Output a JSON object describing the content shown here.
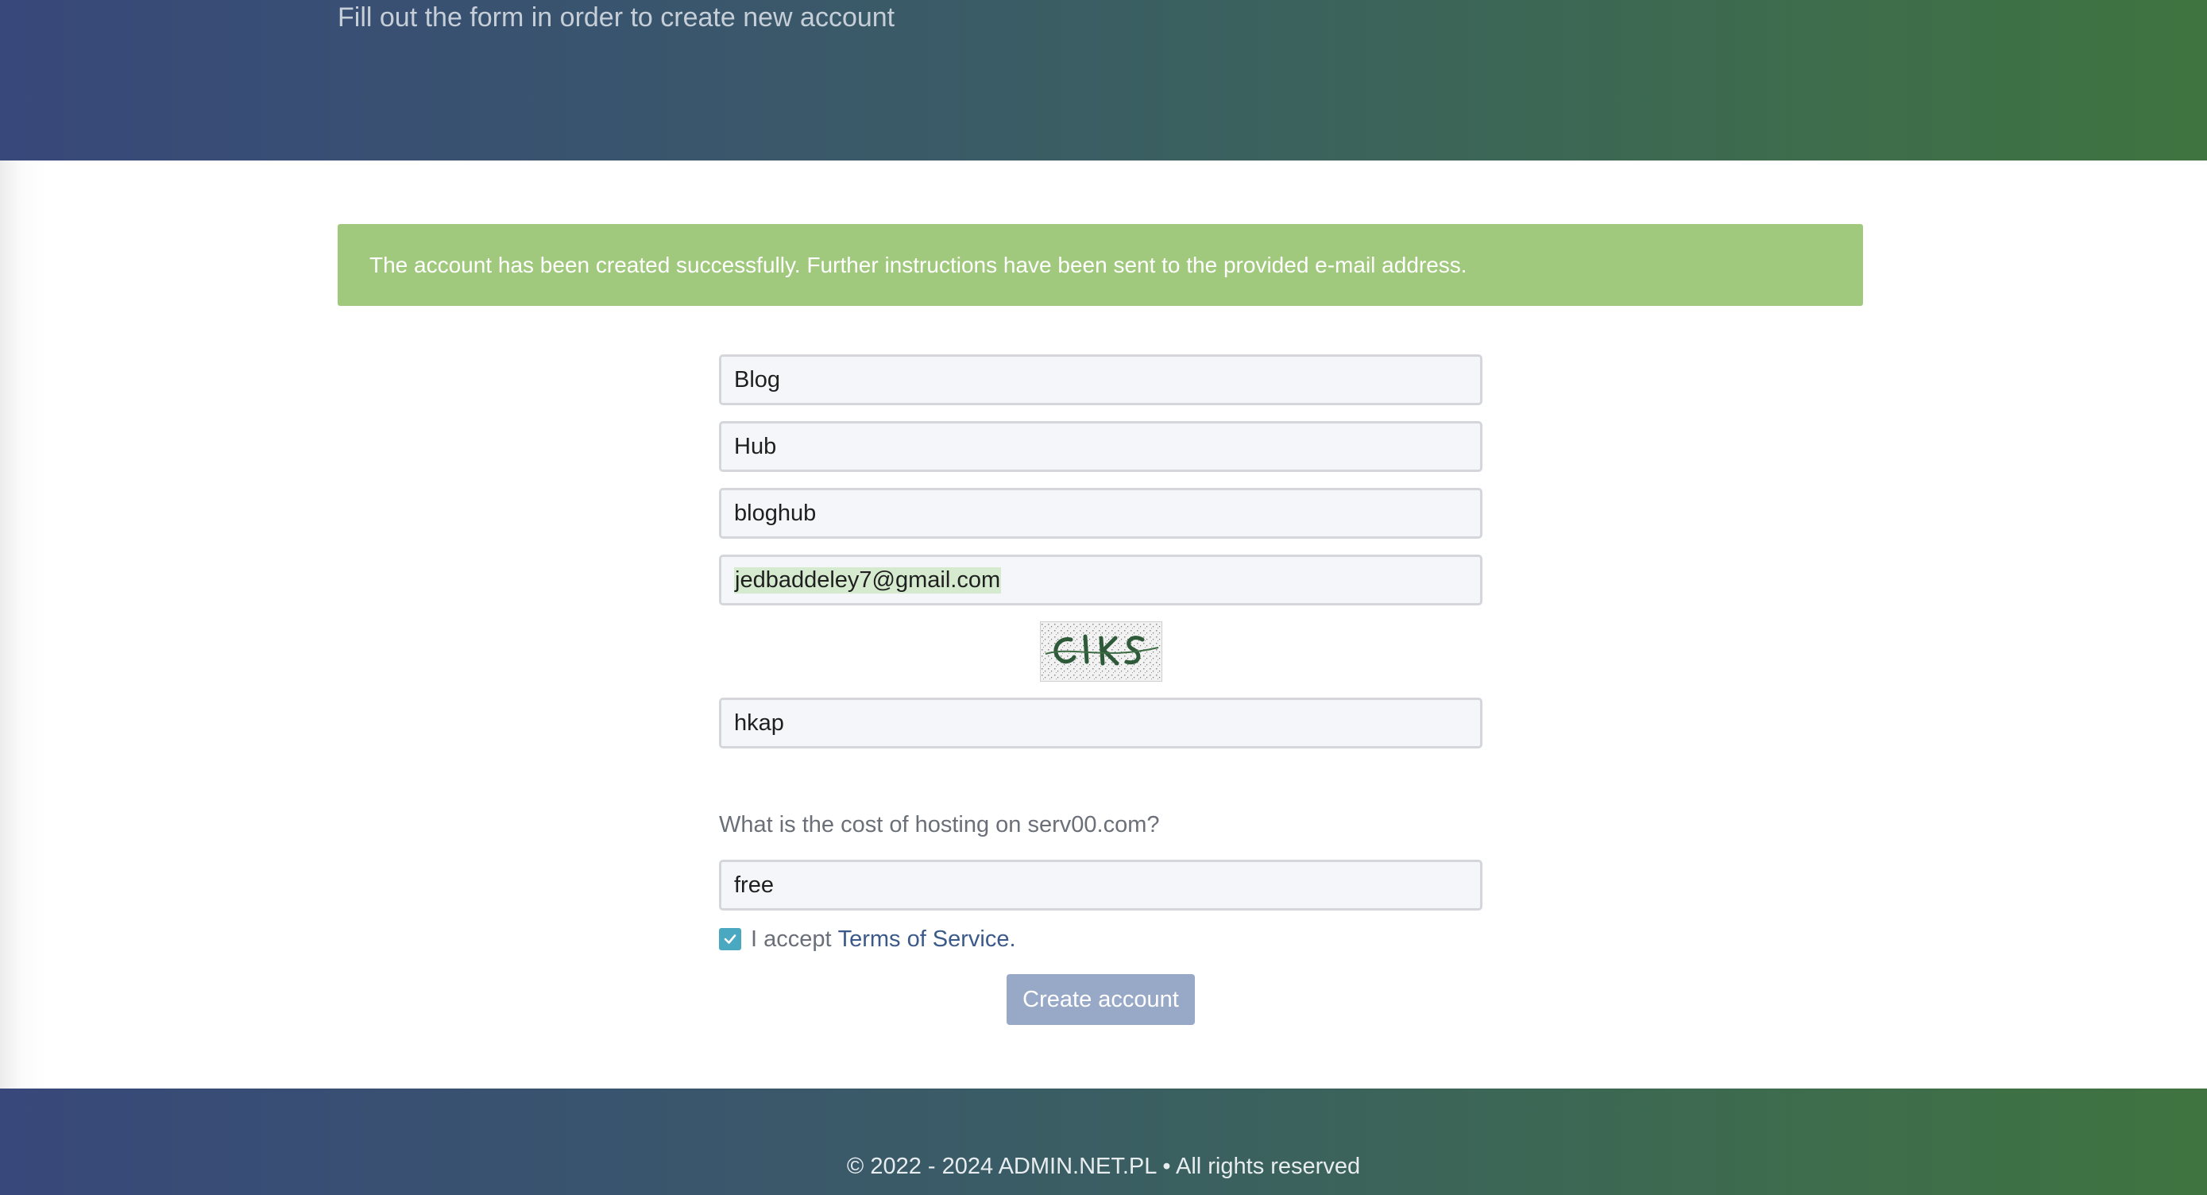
{
  "header": {
    "subtitle": "Fill out the form in order to create new account"
  },
  "alert": {
    "message": "The account has been created successfully. Further instructions have been sent to the provided e-mail address."
  },
  "form": {
    "first_name": "Blog",
    "last_name": "Hub",
    "username": "bloghub",
    "email": "jedbaddeley7@gmail.com",
    "captcha_image_text": "CLKS",
    "captcha_answer": "hkap",
    "question": "What is the cost of hosting on serv00.com?",
    "question_answer": "free",
    "accept_prefix": "I accept",
    "tos_link": "Terms of Service.",
    "accept_checked": true,
    "submit_label": "Create account"
  },
  "footer": {
    "copyright": "© 2022 - 2024 ADMIN.NET.PL • All rights reserved"
  },
  "colors": {
    "alert_bg": "#a1c97d",
    "header_gradient_start": "#38487a",
    "header_gradient_end": "#3f7440",
    "button_bg": "#98a9c7",
    "checkbox_bg": "#4aa8c0",
    "link": "#3b5a8a"
  },
  "icons": {
    "checkbox": "checkmark-icon"
  }
}
